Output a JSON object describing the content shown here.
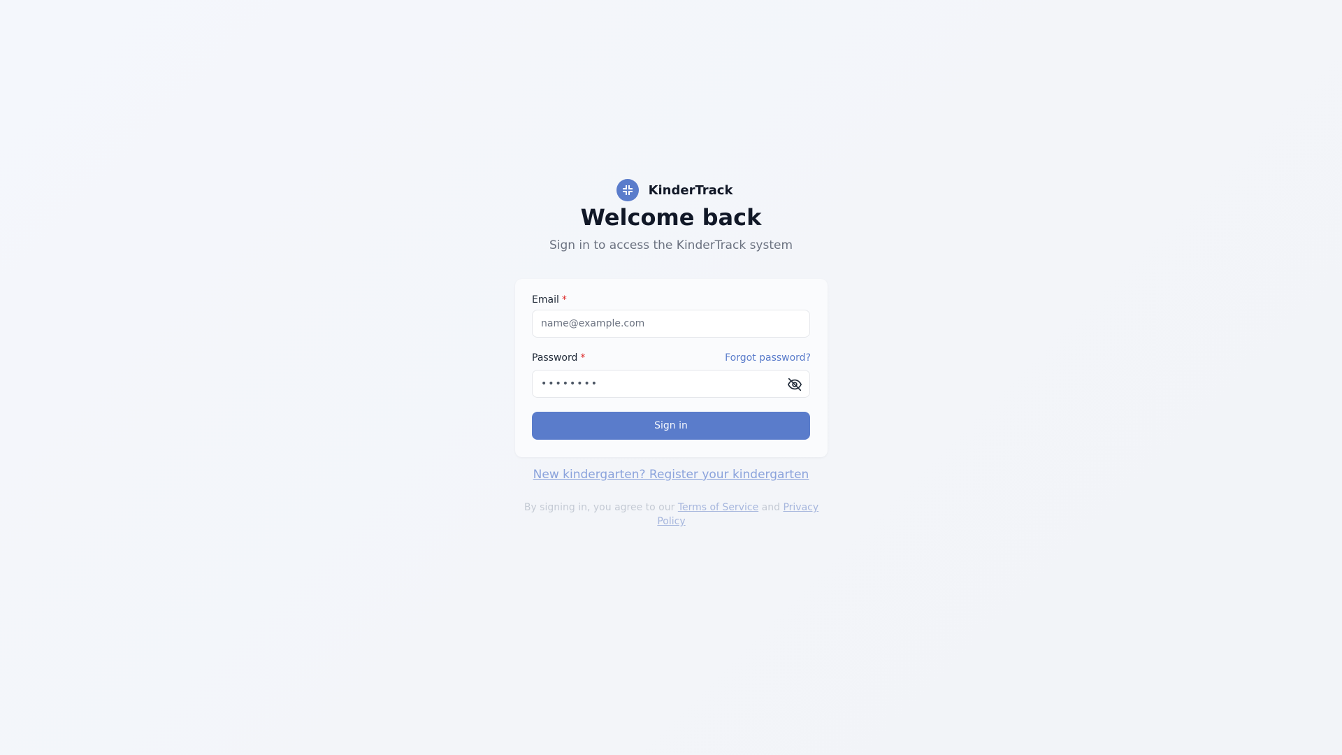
{
  "brand": {
    "name": "KinderTrack",
    "logo_icon": "arrows-collapse-icon",
    "accent_color": "#5a7ccb"
  },
  "header": {
    "title": "Welcome back",
    "subtitle": "Sign in to access the KinderTrack system"
  },
  "form": {
    "email_label": "Email",
    "email_required_mark": "*",
    "email_placeholder": "name@example.com",
    "email_value": "",
    "password_label": "Password",
    "password_required_mark": "*",
    "password_masked_value": "••••••••",
    "forgot_password_label": "Forgot password?",
    "toggle_visibility_icon": "eye-off-icon",
    "submit_label": "Sign in"
  },
  "footer": {
    "register_link": "New kindergarten? Register your kindergarten",
    "terms_prefix": "By signing in, you agree to our ",
    "terms_of_service": "Terms of Service",
    "terms_and": " and ",
    "privacy_policy": "Privacy Policy"
  }
}
